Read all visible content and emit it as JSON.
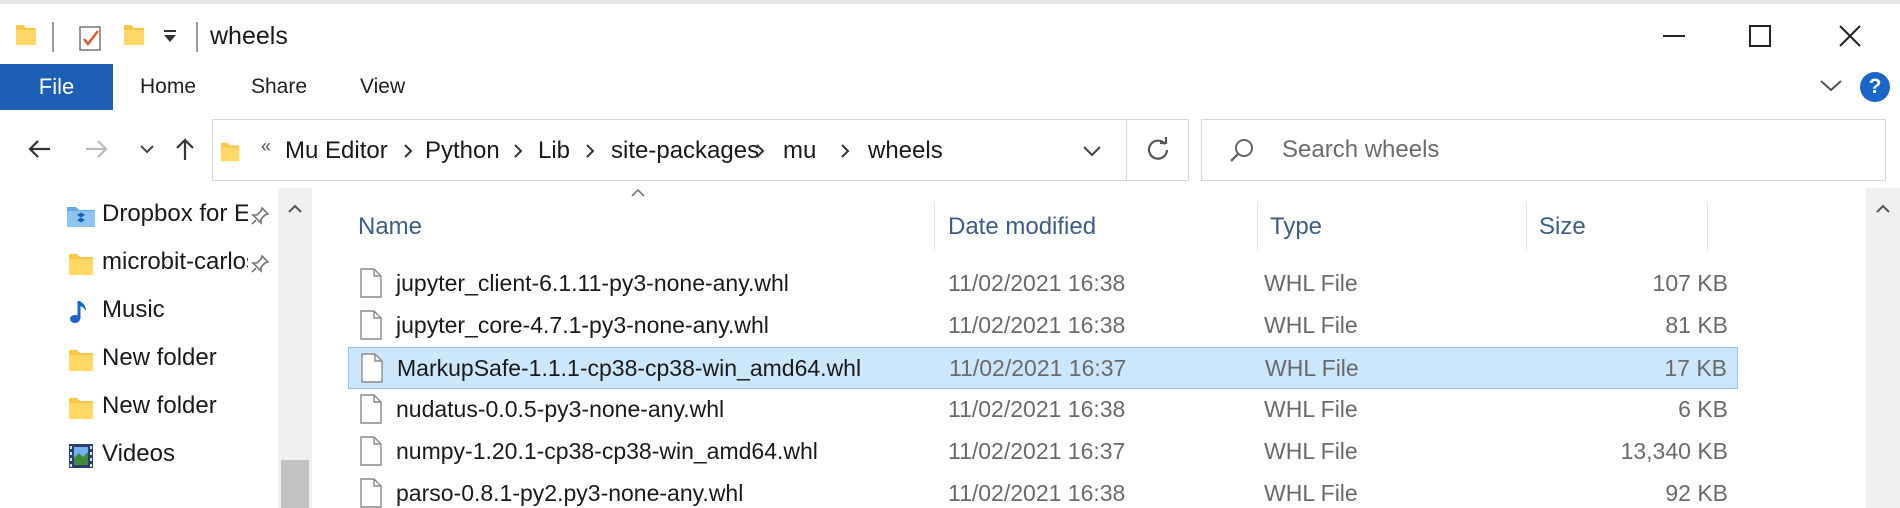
{
  "window": {
    "title": "wheels",
    "minimize_label": "Minimize",
    "maximize_label": "Maximize",
    "close_label": "Close"
  },
  "ribbon": {
    "tabs": [
      {
        "label": "File"
      },
      {
        "label": "Home"
      },
      {
        "label": "Share"
      },
      {
        "label": "View"
      }
    ],
    "help_label": "?"
  },
  "address": {
    "more": "«",
    "crumbs": [
      "Mu Editor",
      "Python",
      "Lib",
      "site-packages",
      "mu",
      "wheels"
    ]
  },
  "search": {
    "placeholder": "Search wheels"
  },
  "nav_pane": {
    "items": [
      {
        "label": "Dropbox for Education",
        "icon": "dropbox-folder-icon",
        "pinned": true
      },
      {
        "label": "microbit-carlos",
        "icon": "folder-icon",
        "pinned": true
      },
      {
        "label": "Music",
        "icon": "music-icon",
        "pinned": false
      },
      {
        "label": "New folder",
        "icon": "folder-icon",
        "pinned": false
      },
      {
        "label": "New folder",
        "icon": "folder-icon",
        "pinned": false
      },
      {
        "label": "Videos",
        "icon": "videos-icon",
        "pinned": false
      }
    ]
  },
  "file_list": {
    "columns": {
      "name": "Name",
      "date": "Date modified",
      "type": "Type",
      "size": "Size"
    },
    "rows": [
      {
        "name": "jupyter_client-6.1.11-py3-none-any.whl",
        "date": "11/02/2021 16:38",
        "type": "WHL File",
        "size": "107 KB",
        "selected": false
      },
      {
        "name": "jupyter_core-4.7.1-py3-none-any.whl",
        "date": "11/02/2021 16:38",
        "type": "WHL File",
        "size": "81 KB",
        "selected": false
      },
      {
        "name": "MarkupSafe-1.1.1-cp38-cp38-win_amd64.whl",
        "date": "11/02/2021 16:37",
        "type": "WHL File",
        "size": "17 KB",
        "selected": true
      },
      {
        "name": "nudatus-0.0.5-py3-none-any.whl",
        "date": "11/02/2021 16:38",
        "type": "WHL File",
        "size": "6 KB",
        "selected": false
      },
      {
        "name": "numpy-1.20.1-cp38-cp38-win_amd64.whl",
        "date": "11/02/2021 16:37",
        "type": "WHL File",
        "size": "13,340 KB",
        "selected": false
      },
      {
        "name": "parso-0.8.1-py2.py3-none-any.whl",
        "date": "11/02/2021 16:38",
        "type": "WHL File",
        "size": "92 KB",
        "selected": false
      }
    ]
  },
  "colors": {
    "accent": "#1c5fb4",
    "selection": "#cce6fb",
    "folder": "#f8c748",
    "header_text": "#3b5d86"
  }
}
